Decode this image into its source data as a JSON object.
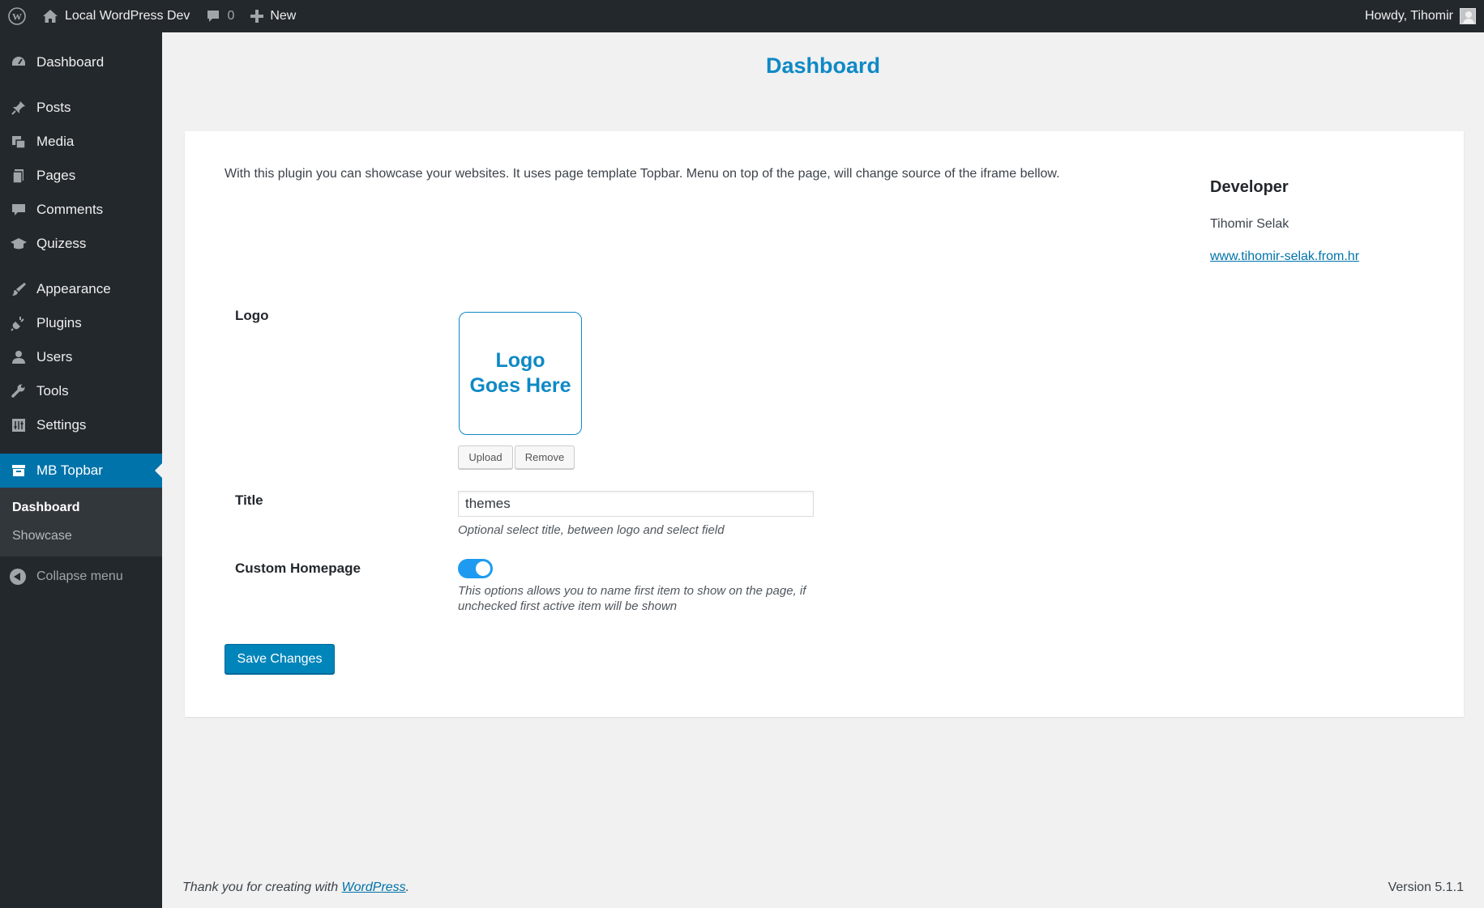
{
  "adminbar": {
    "site_name": "Local WordPress Dev",
    "comments_count": "0",
    "new_label": "New",
    "howdy": "Howdy, Tihomir"
  },
  "sidebar": {
    "items": [
      {
        "label": "Dashboard",
        "icon": "dashboard-icon"
      },
      {
        "label": "Posts",
        "icon": "pin-icon"
      },
      {
        "label": "Media",
        "icon": "media-icon"
      },
      {
        "label": "Pages",
        "icon": "pages-icon"
      },
      {
        "label": "Comments",
        "icon": "comment-icon"
      },
      {
        "label": "Quizess",
        "icon": "graduation-cap-icon"
      },
      {
        "label": "Appearance",
        "icon": "brush-icon"
      },
      {
        "label": "Plugins",
        "icon": "plug-icon"
      },
      {
        "label": "Users",
        "icon": "user-icon"
      },
      {
        "label": "Tools",
        "icon": "wrench-icon"
      },
      {
        "label": "Settings",
        "icon": "settings-icon"
      },
      {
        "label": "MB Topbar",
        "icon": "archive-icon"
      }
    ],
    "submenu": [
      "Dashboard",
      "Showcase"
    ],
    "collapse_label": "Collapse menu"
  },
  "page": {
    "title": "Dashboard",
    "intro": "With this plugin you can showcase your websites. It uses page template Topbar. Menu on top of the page, will change source of the iframe bellow."
  },
  "developer": {
    "heading": "Developer",
    "name": "Tihomir Selak",
    "link": "www.tihomir-selak.from.hr"
  },
  "form": {
    "logo_label": "Logo",
    "logo_placeholder": "Logo Goes Here",
    "upload_label": "Upload",
    "remove_label": "Remove",
    "title_label": "Title",
    "title_value": "themes",
    "title_desc": "Optional select title, between logo and select field",
    "homepage_label": "Custom Homepage",
    "homepage_enabled": true,
    "homepage_desc_1": "This options allows you to name first item to show on the page, if",
    "homepage_desc_2": "unchecked first active item will be shown",
    "save_label": "Save Changes"
  },
  "footer": {
    "thanks_prefix": "Thank you for creating with ",
    "thanks_link": "WordPress",
    "thanks_suffix": ".",
    "version": "Version 5.1.1"
  },
  "colors": {
    "accent": "#0073aa",
    "title_blue": "#0e89c6",
    "toggle_on": "#1e9bf0",
    "sidebar_bg": "#23282d"
  }
}
